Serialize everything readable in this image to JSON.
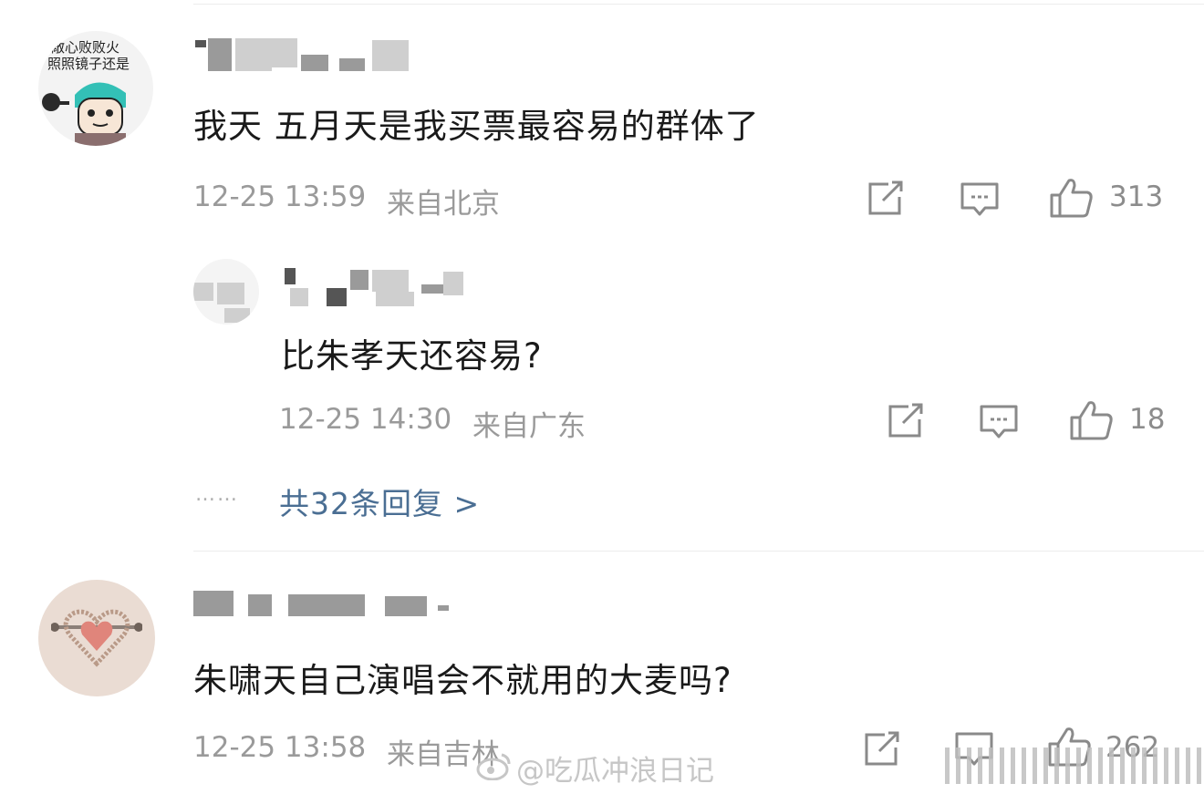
{
  "comments": [
    {
      "avatar_text": [
        "敵心败败火",
        "照照镜子还是"
      ],
      "body": "我天 五月天是我买票最容易的群体了",
      "time": "12-25 13:59",
      "location": "来自北京",
      "likes": "313"
    },
    {
      "body": "朱啸天自己演唱会不就用的大麦吗?",
      "time": "12-25 13:58",
      "location": "来自吉林",
      "likes": "262"
    }
  ],
  "reply": {
    "body": "比朱孝天还容易?",
    "time": "12-25 14:30",
    "location": "来自广东",
    "likes": "18"
  },
  "more_replies": {
    "dots": "……",
    "label": "共32条回复 >"
  },
  "watermark": "@吃瓜冲浪日记",
  "icons": [
    "share-icon",
    "comment-icon",
    "like-icon",
    "weibo-logo-icon"
  ]
}
